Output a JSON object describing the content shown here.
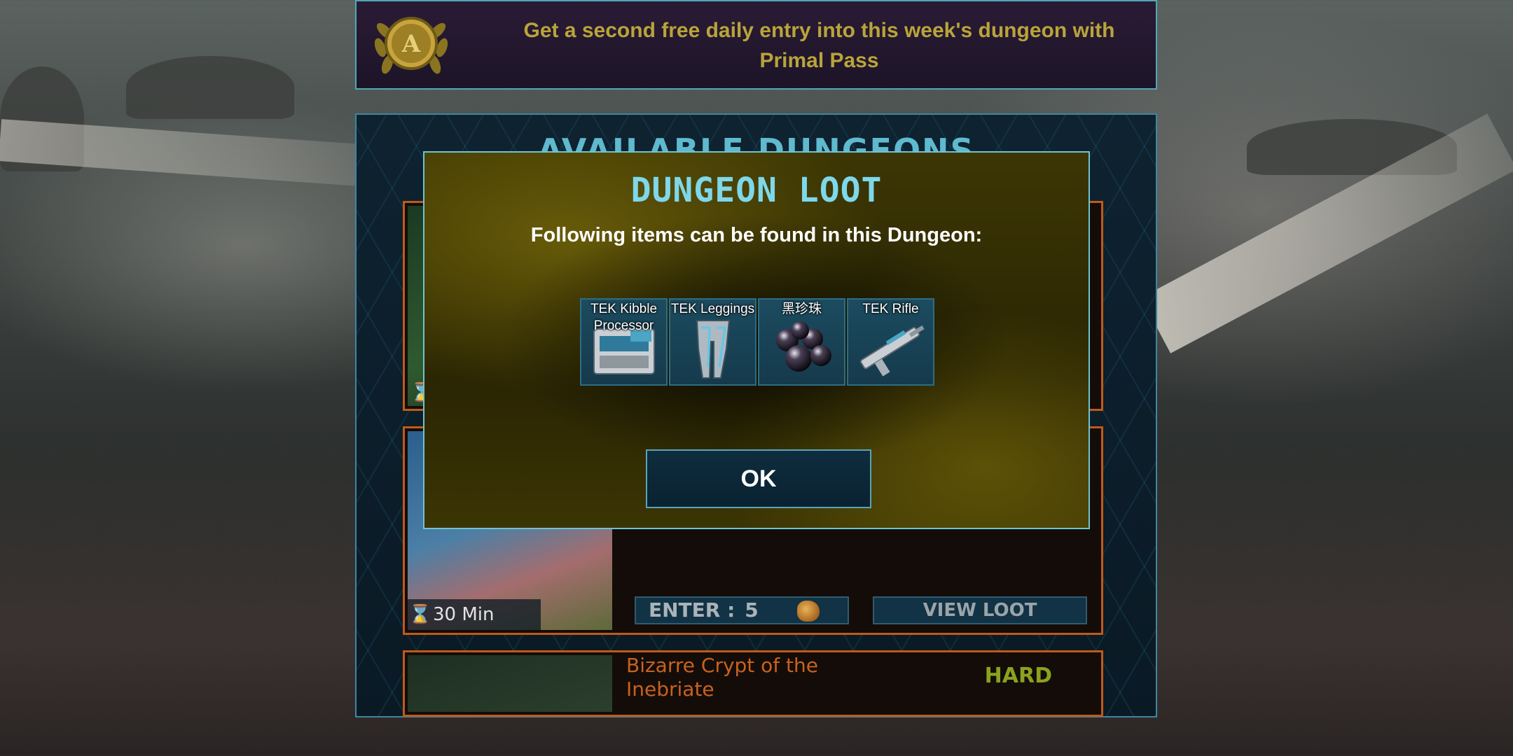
{
  "banner": {
    "text": "Get a second free daily entry into this week's dungeon with Primal Pass",
    "medal_letter": "A"
  },
  "panel": {
    "title": "AVAILABLE DUNGEONS",
    "cards": [
      {
        "time": "",
        "enter_label": "",
        "enter_value": "",
        "viewloot": ""
      },
      {
        "time": "30 Min",
        "enter_label": "ENTER :",
        "enter_value": "5",
        "viewloot": "VIEW LOOT"
      },
      {
        "name": "Bizarre Crypt of the Inebriate",
        "difficulty": "HARD"
      }
    ]
  },
  "modal": {
    "title": "DUNGEON LOOT",
    "subtitle": "Following items can be found in this Dungeon:",
    "items": [
      {
        "name": "TEK Kibble Processor",
        "icon": "kibble-processor-icon"
      },
      {
        "name": "TEK Leggings",
        "icon": "leggings-icon"
      },
      {
        "name": "黑珍珠",
        "icon": "black-pearl-icon"
      },
      {
        "name": "TEK Rifle",
        "icon": "rifle-icon"
      }
    ],
    "ok_label": "OK"
  },
  "colors": {
    "accent": "#7ed8ea",
    "banner_text": "#b9a43a",
    "card_border": "#c05a1a",
    "difficulty_hard": "#8aa21f"
  }
}
